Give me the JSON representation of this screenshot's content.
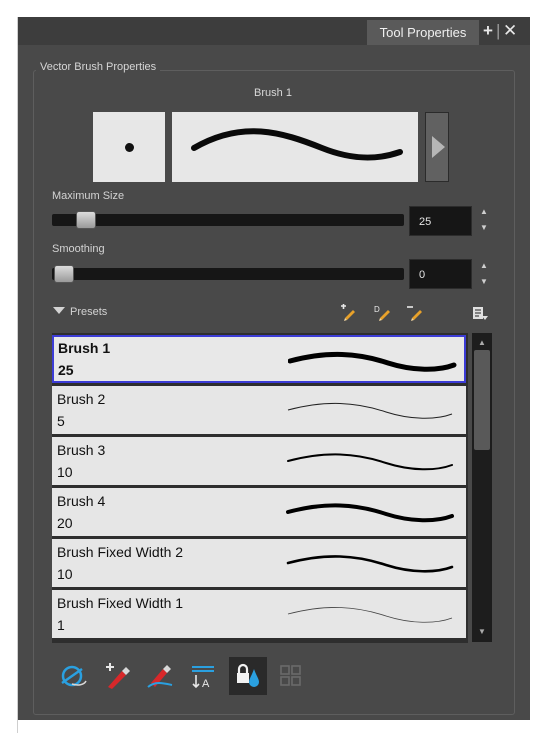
{
  "tab": {
    "title": "Tool Properties",
    "add_icon": "plus-icon",
    "close_icon": "close-icon"
  },
  "group_title": "Vector Brush Properties",
  "brush_name": "Brush 1",
  "max_size": {
    "label": "Maximum Size",
    "value": "25",
    "slider_fraction": 0.1
  },
  "smoothing": {
    "label": "Smoothing",
    "value": "0",
    "slider_fraction": 0.0
  },
  "presets": {
    "label": "Presets",
    "toolbar_icons": [
      "new-preset-icon",
      "rename-preset-icon",
      "delete-preset-icon",
      "presets-menu-icon"
    ],
    "items": [
      {
        "name": "Brush 1",
        "size": "25",
        "selected": true
      },
      {
        "name": "Brush 2",
        "size": "5",
        "selected": false
      },
      {
        "name": "Brush 3",
        "size": "10",
        "selected": false
      },
      {
        "name": "Brush 4",
        "size": "20",
        "selected": false
      },
      {
        "name": "Brush Fixed Width 2",
        "size": "10",
        "selected": false
      },
      {
        "name": "Brush Fixed Width 1",
        "size": "1",
        "selected": false
      }
    ]
  },
  "bottom_toolbar": [
    "auto-flatten-icon",
    "draw-behind-icon",
    "respect-protected-icon",
    "text-tool-icon",
    "lock-ink-icon",
    "grid-icon"
  ],
  "colors": {
    "selection": "#3c3cd6",
    "panel": "#494949",
    "accent_blue": "#2aa0e0",
    "accent_red": "#d8282a"
  }
}
